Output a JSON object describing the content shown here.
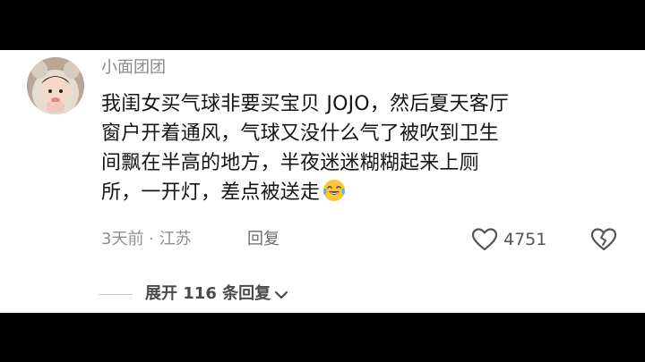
{
  "comment": {
    "username": "小面团团",
    "text_lines": [
      "我闺女买气球非要买宝贝 JOJO，然后夏天客厅",
      "窗户开着通风，气球又没什么气了被吹到卫生",
      "间飘在半高的地方，半夜迷迷糊糊起来上厕",
      "所，一开灯，差点被送走"
    ],
    "emoji_icon": "tears-of-joy-emoji",
    "time_location": "3天前 · 江苏",
    "reply_label": "回复",
    "like_count": "4751",
    "icons": {
      "like": "heart-outline-icon",
      "dislike": "broken-heart-icon",
      "expand": "chevron-down-icon"
    }
  },
  "replies": {
    "expand_label": "展开 116 条回复"
  },
  "colors": {
    "background": "#ffffff",
    "letterbox": "#000000",
    "username": "#8a8a8a",
    "comment_text": "#141414",
    "meta_text": "#8f8f8f"
  }
}
